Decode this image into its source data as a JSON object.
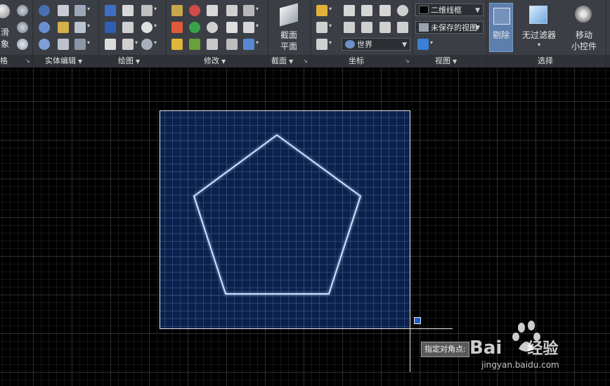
{
  "ribbon": {
    "panels": [
      {
        "label": "网格",
        "has_menu": false
      },
      {
        "label": "实体编辑",
        "has_menu": true
      },
      {
        "label": "绘图",
        "has_menu": true
      },
      {
        "label": "修改",
        "has_menu": true
      },
      {
        "label": "截面",
        "has_menu": true
      },
      {
        "label": "坐标",
        "has_menu": false
      },
      {
        "label": "视图",
        "has_menu": true
      },
      {
        "label": "选择",
        "has_menu": false
      }
    ],
    "left_partial": {
      "line1": "滑",
      "line2": "象"
    },
    "section_plane": {
      "line1": "截面",
      "line2": "平面"
    },
    "ucs_combo": {
      "value": "世界"
    },
    "visual_style_combo": {
      "value": "二维线框"
    },
    "named_view_combo": {
      "value": "未保存的视图"
    },
    "cull_button": {
      "label": "剔除"
    },
    "no_filter_button": {
      "label": "无过滤器"
    },
    "move_gizmo_button": {
      "line1": "移动",
      "line2": "小控件"
    }
  },
  "canvas": {
    "prompt_tooltip": "指定对角点:",
    "selection_mode": "window"
  },
  "watermark": {
    "brand": "Bai",
    "brand2": "经验",
    "url": "jingyan.baidu.com"
  },
  "colors": {
    "ribbon_bg": "#3b3f45",
    "canvas_bg": "#000000",
    "selection_fill": "#143c8c",
    "pentagon_stroke": "#cfe4ff",
    "active_button": "#5d7fae"
  }
}
